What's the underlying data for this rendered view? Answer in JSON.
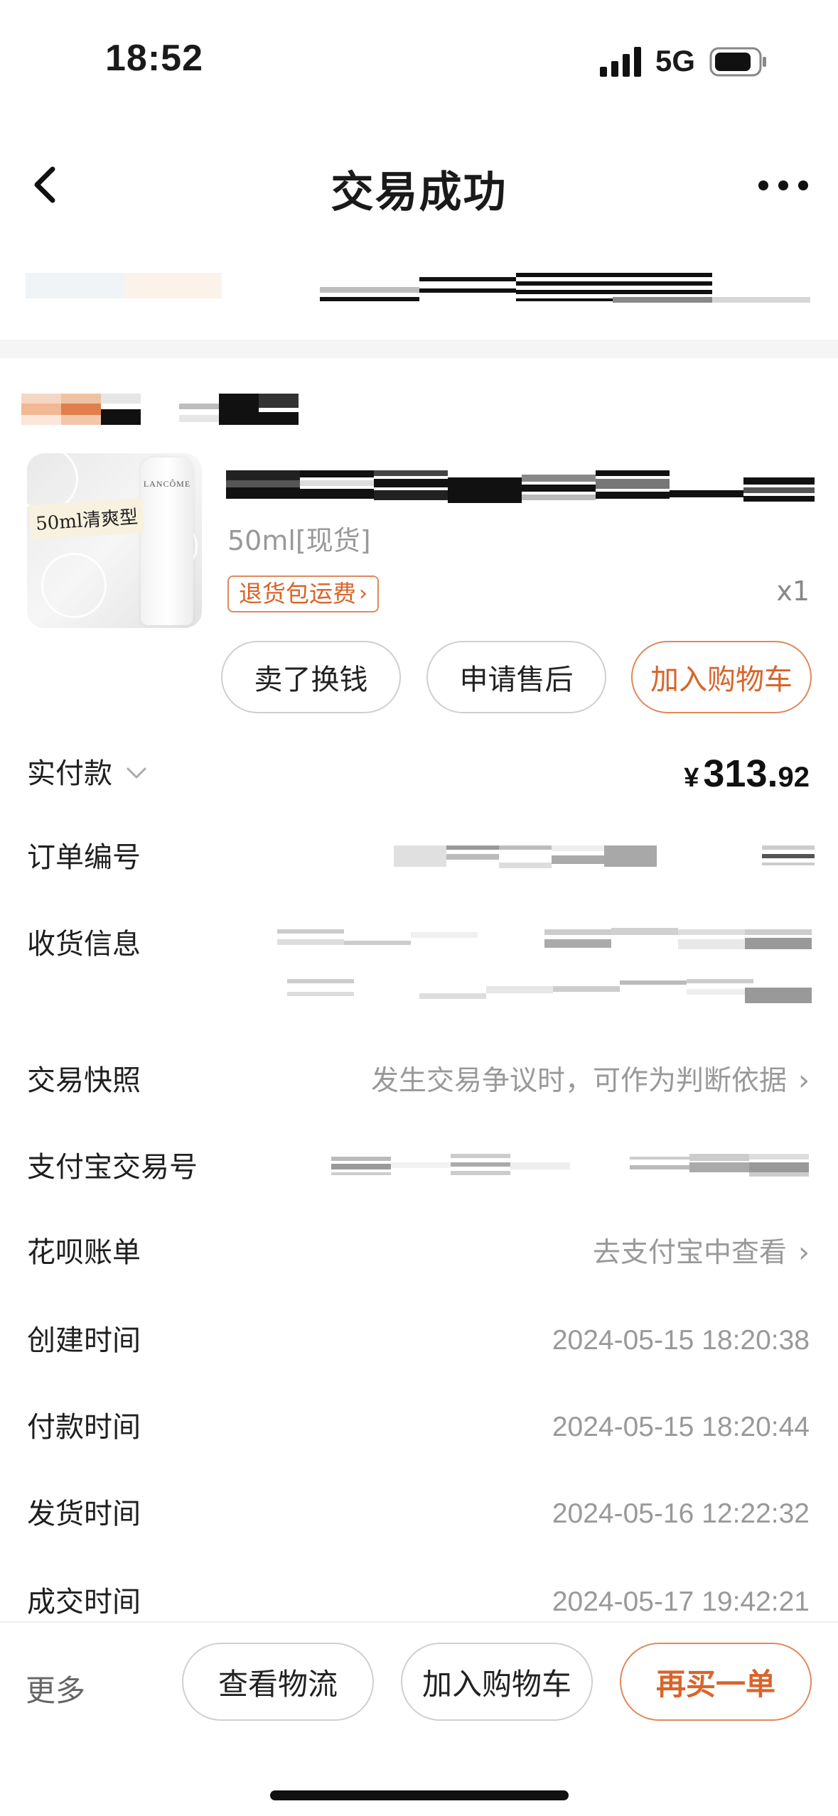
{
  "status_bar": {
    "time": "18:52",
    "network": "5G"
  },
  "nav": {
    "title": "交易成功"
  },
  "product": {
    "thumbnail": {
      "tag": "50ml清爽型",
      "brand": "LANCÔME"
    },
    "variant": "50ml[现货]",
    "refund_badge": "退货包运费",
    "quantity": "x1",
    "actions": {
      "sell": "卖了换钱",
      "after_sale": "申请售后",
      "add_to_cart": "加入购物车"
    }
  },
  "info": {
    "paid": {
      "label": "实付款",
      "currency": "¥",
      "amount_int": "313.",
      "amount_dec": "92"
    },
    "order_no": {
      "label": "订单编号"
    },
    "shipping_info": {
      "label": "收货信息"
    },
    "snapshot": {
      "label": "交易快照",
      "value": "发生交易争议时，可作为判断依据"
    },
    "alipay_no": {
      "label": "支付宝交易号"
    },
    "huabei": {
      "label": "花呗账单",
      "value": "去支付宝中查看"
    },
    "created": {
      "label": "创建时间",
      "value": "2024-05-15 18:20:38"
    },
    "paid_time": {
      "label": "付款时间",
      "value": "2024-05-15 18:20:44"
    },
    "shipped": {
      "label": "发货时间",
      "value": "2024-05-16 12:22:32"
    },
    "completed": {
      "label": "成交时间",
      "value": "2024-05-17 19:42:21"
    }
  },
  "bottom_bar": {
    "more": "更多",
    "logistics": "查看物流",
    "add_to_cart": "加入购物车",
    "rebuy": "再买一单"
  },
  "colors": {
    "accent": "#d9642a",
    "accent_border": "#e0895a",
    "muted": "#999999",
    "divider": "#f5f5f5"
  }
}
